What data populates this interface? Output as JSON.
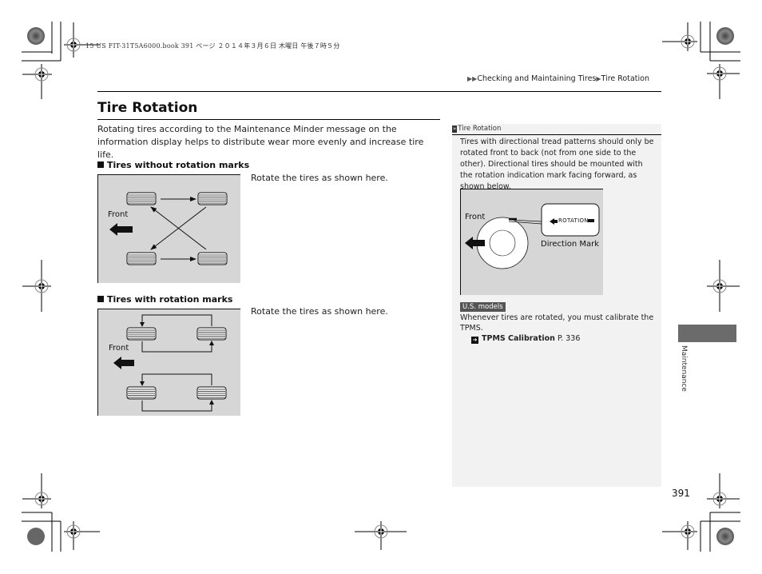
{
  "print_header": "15 US FIT-31T5A6000.book  391 ページ  ２０１４年３月６日  木曜日  午後７時５分",
  "breadcrumb": {
    "items": [
      "Checking and Maintaining Tires",
      "Tire Rotation"
    ]
  },
  "page_title": "Tire Rotation",
  "intro": "Rotating tires according to the Maintenance Minder message on the information display helps to distribute wear more evenly and increase tire life.",
  "sections": [
    {
      "heading": "Tires without rotation marks",
      "caption": "Rotate the tires as shown here.",
      "figure_label": "Front"
    },
    {
      "heading": "Tires with rotation marks",
      "caption": "Rotate the tires as shown here.",
      "figure_label": "Front"
    }
  ],
  "sidebar": {
    "label": "Tire Rotation",
    "label_icon": "double-chevron-icon",
    "text": "Tires with directional tread patterns should only be rotated front to back (not from one side to the other). Directional tires should be mounted with the rotation indication mark facing forward, as shown below.",
    "figure": {
      "front_label": "Front",
      "rotation_text": "ROTATION",
      "direction_label": "Direction Mark"
    },
    "badge": "U.S. models",
    "note": "Whenever tires are rotated, you must calibrate the TPMS.",
    "xref": {
      "title": "TPMS Calibration",
      "page": "P. 336"
    }
  },
  "chapter_label": "Maintenance",
  "page_number": "391",
  "colors": {
    "figure_bg": "#d6d6d6",
    "sidebar_bg": "#f2f2f2",
    "chapter_tab": "#6b6b6b",
    "badge_bg": "#555555"
  }
}
